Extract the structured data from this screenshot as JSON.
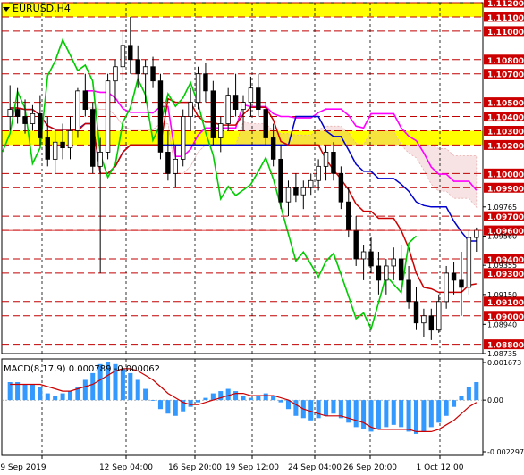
{
  "chart_title": "EURUSD,H4",
  "macd_label": "MACD(8,17,9) 0.000789 -0.000062",
  "colors": {
    "bull_candle": "#000000",
    "bear_candle": "#000000",
    "signal_red": "#cc0000",
    "kijun_blue": "#0000cc",
    "chikou_green": "#00cc00",
    "tenkan_magenta": "#ff00ff",
    "cloud_hatch": "#e8b0b0",
    "resistance_zone": "#ffff00",
    "level_lines": "#c00000",
    "price_label_bg": "#cc0000",
    "current_price_bg": "#cc0000",
    "macd_hist": "#3399ff",
    "macd_signal": "#cc0000"
  },
  "chart_data": {
    "type": "candlestick",
    "symbol": "EURUSD",
    "timeframe": "H4",
    "price_axis": {
      "min": 1.08735,
      "max": 1.112,
      "tick_labels": [
        "1.11200",
        "1.11100",
        "1.11000",
        "1.10800",
        "1.10700",
        "1.10500",
        "1.10400",
        "1.10300",
        "1.10200",
        "1.10000",
        "1.09900",
        "1.09765",
        "1.09700",
        "1.09600",
        "1.09560",
        "1.09400",
        "1.09355",
        "1.09300",
        "1.09150",
        "1.09100",
        "1.09000",
        "1.08940",
        "1.08800",
        "1.08735"
      ]
    },
    "time_axis_labels": [
      "9 Sep 2019",
      "12 Sep 04:00",
      "16 Sep 20:00",
      "19 Sep 12:00",
      "24 Sep 04:00",
      "26 Sep 20:00",
      "1 Oct 12:00"
    ],
    "horizontal_levels": [
      1.112,
      1.111,
      1.11,
      1.108,
      1.107,
      1.105,
      1.104,
      1.103,
      1.102,
      1.1,
      1.099,
      1.097,
      1.096,
      1.094,
      1.093,
      1.091,
      1.09,
      1.088
    ],
    "highlighted_levels": [
      {
        "price": 1.112,
        "text": "1.11200"
      },
      {
        "price": 1.111,
        "text": "1.11100"
      },
      {
        "price": 1.11,
        "text": "1.11000"
      },
      {
        "price": 1.108,
        "text": "1.10800"
      },
      {
        "price": 1.107,
        "text": "1.10700"
      },
      {
        "price": 1.105,
        "text": "1.10500"
      },
      {
        "price": 1.104,
        "text": "1.10400"
      },
      {
        "price": 1.103,
        "text": "1.10300"
      },
      {
        "price": 1.102,
        "text": "1.10200"
      },
      {
        "price": 1.1,
        "text": "1.10000"
      },
      {
        "price": 1.099,
        "text": "1.09900"
      },
      {
        "price": 1.097,
        "text": "1.09700"
      },
      {
        "price": 1.096,
        "text": "1.09600"
      },
      {
        "price": 1.094,
        "text": "1.09400"
      },
      {
        "price": 1.093,
        "text": "1.09300"
      },
      {
        "price": 1.091,
        "text": "1.09100"
      },
      {
        "price": 1.09,
        "text": "1.09000"
      },
      {
        "price": 1.088,
        "text": "1.08800"
      }
    ],
    "plain_levels": [
      {
        "price": 1.09765,
        "text": "1.09765"
      },
      {
        "price": 1.0956,
        "text": "1.09560"
      },
      {
        "price": 1.09355,
        "text": "1.09355"
      },
      {
        "price": 1.0915,
        "text": "1.09150"
      },
      {
        "price": 1.0894,
        "text": "1.08940"
      },
      {
        "price": 1.08735,
        "text": "1.08735"
      }
    ],
    "current_price": {
      "price": 1.096,
      "text": "1.09600"
    },
    "yellow_zones": [
      [
        1.111,
        1.112
      ],
      [
        1.102,
        1.103
      ]
    ],
    "candles": [
      [
        1.104,
        1.1062,
        1.103,
        1.1045
      ],
      [
        1.1045,
        1.106,
        1.1035,
        1.104
      ],
      [
        1.104,
        1.1052,
        1.1028,
        1.1035
      ],
      [
        1.1035,
        1.1048,
        1.103,
        1.1042
      ],
      [
        1.1042,
        1.1055,
        1.102,
        1.1025
      ],
      [
        1.1025,
        1.104,
        1.1005,
        1.101
      ],
      [
        1.101,
        1.103,
        1.1,
        1.1022
      ],
      [
        1.1022,
        1.1035,
        1.101,
        1.1018
      ],
      [
        1.1018,
        1.104,
        1.101,
        1.103
      ],
      [
        1.103,
        1.106,
        1.1025,
        1.1058
      ],
      [
        1.1058,
        1.107,
        1.104,
        1.1045
      ],
      [
        1.1045,
        1.105,
        1.1,
        1.1005
      ],
      [
        1.1005,
        1.1025,
        1.093,
        1.1015
      ],
      [
        1.1015,
        1.107,
        1.101,
        1.1065
      ],
      [
        1.1065,
        1.108,
        1.105,
        1.1075
      ],
      [
        1.1075,
        1.11,
        1.1065,
        1.109
      ],
      [
        1.109,
        1.111,
        1.107,
        1.108
      ],
      [
        1.108,
        1.109,
        1.106,
        1.107
      ],
      [
        1.107,
        1.108,
        1.105,
        1.1075
      ],
      [
        1.1075,
        1.1082,
        1.106,
        1.1065
      ],
      [
        1.1065,
        1.107,
        1.101,
        1.1015
      ],
      [
        1.1015,
        1.103,
        1.0995,
        1.1
      ],
      [
        1.1,
        1.102,
        1.099,
        1.101
      ],
      [
        1.101,
        1.1045,
        1.1005,
        1.104
      ],
      [
        1.104,
        1.106,
        1.103,
        1.105
      ],
      [
        1.105,
        1.1075,
        1.1045,
        1.107
      ],
      [
        1.107,
        1.1078,
        1.105,
        1.1058
      ],
      [
        1.1058,
        1.1065,
        1.102,
        1.1025
      ],
      [
        1.1025,
        1.104,
        1.1015,
        1.1035
      ],
      [
        1.1035,
        1.106,
        1.103,
        1.1055
      ],
      [
        1.1055,
        1.107,
        1.104,
        1.1045
      ],
      [
        1.1045,
        1.1055,
        1.103,
        1.105
      ],
      [
        1.105,
        1.1068,
        1.104,
        1.106
      ],
      [
        1.106,
        1.107,
        1.104,
        1.1045
      ],
      [
        1.1045,
        1.105,
        1.102,
        1.1025
      ],
      [
        1.1025,
        1.1035,
        1.1005,
        1.101
      ],
      [
        1.101,
        1.102,
        1.0975,
        1.098
      ],
      [
        1.098,
        1.0995,
        1.097,
        1.099
      ],
      [
        1.099,
        1.1,
        1.098,
        1.0985
      ],
      [
        1.0985,
        1.0995,
        1.0975,
        1.099
      ],
      [
        1.099,
        1.1,
        1.0985,
        1.0995
      ],
      [
        1.0995,
        1.101,
        1.0988,
        1.1005
      ],
      [
        1.1005,
        1.102,
        1.0995,
        1.1015
      ],
      [
        1.1015,
        1.1022,
        1.0995,
        1.1
      ],
      [
        1.1,
        1.1005,
        1.0975,
        1.098
      ],
      [
        1.098,
        1.099,
        1.0955,
        1.096
      ],
      [
        1.096,
        1.097,
        1.0935,
        1.094
      ],
      [
        1.094,
        1.095,
        1.0925,
        1.0945
      ],
      [
        1.0945,
        1.0955,
        1.093,
        1.0935
      ],
      [
        1.0935,
        1.0945,
        1.0915,
        1.0925
      ],
      [
        1.0925,
        1.094,
        1.0915,
        1.0935
      ],
      [
        1.0935,
        1.0948,
        1.0925,
        1.094
      ],
      [
        1.094,
        1.095,
        1.092,
        1.0925
      ],
      [
        1.0925,
        1.0935,
        1.0905,
        1.091
      ],
      [
        1.091,
        1.092,
        1.089,
        1.0895
      ],
      [
        1.0895,
        1.0905,
        1.0885,
        1.09
      ],
      [
        1.09,
        1.0905,
        1.0883,
        1.089
      ],
      [
        1.089,
        1.0915,
        1.0888,
        1.091
      ],
      [
        1.091,
        1.0935,
        1.0905,
        1.093
      ],
      [
        1.093,
        1.0938,
        1.0915,
        1.0925
      ],
      [
        1.0925,
        1.0945,
        1.09,
        1.092
      ],
      [
        1.092,
        1.096,
        1.0915,
        1.0955
      ],
      [
        1.0955,
        1.0962,
        1.0945,
        1.096
      ]
    ],
    "macd_axis": {
      "min": -0.002297,
      "max": 0.001673,
      "tick_labels": [
        "0.001673",
        "0.00",
        "-0.002297"
      ]
    },
    "macd_histogram": [
      0.0008,
      0.0008,
      0.0007,
      0.0007,
      0.0006,
      0.0003,
      0.0002,
      0.0003,
      0.0004,
      0.0006,
      0.0009,
      0.0012,
      0.0016,
      0.0017,
      0.0016,
      0.0014,
      0.0012,
      0.0009,
      0.0005,
      0.0,
      -0.0004,
      -0.0006,
      -0.0007,
      -0.0005,
      -0.0003,
      -0.0001,
      0.0001,
      0.0003,
      0.0004,
      0.0005,
      0.0004,
      0.0002,
      0.0001,
      0.0002,
      0.0003,
      0.0002,
      -0.0001,
      -0.0004,
      -0.0007,
      -0.0008,
      -0.0009,
      -0.0008,
      -0.0007,
      -0.0006,
      -0.0008,
      -0.001,
      -0.0012,
      -0.0013,
      -0.0014,
      -0.0013,
      -0.0012,
      -0.0011,
      -0.0012,
      -0.0014,
      -0.0015,
      -0.0014,
      -0.0012,
      -0.001,
      -0.0007,
      -0.0003,
      0.0002,
      0.0006,
      0.0008
    ],
    "macd_signal": [
      0.0007,
      0.0007,
      0.0007,
      0.0007,
      0.0007,
      0.0006,
      0.0005,
      0.0004,
      0.0004,
      0.0005,
      0.0006,
      0.0007,
      0.0009,
      0.0011,
      0.0013,
      0.0014,
      0.0014,
      0.0013,
      0.0011,
      0.0009,
      0.0006,
      0.0003,
      0.0001,
      -0.0001,
      -0.0002,
      -0.0002,
      -0.0001,
      0.0,
      0.0001,
      0.0002,
      0.0003,
      0.0003,
      0.0002,
      0.0002,
      0.0002,
      0.0002,
      0.0001,
      0.0,
      -0.0002,
      -0.0004,
      -0.0005,
      -0.0006,
      -0.0007,
      -0.0007,
      -0.0007,
      -0.0008,
      -0.0009,
      -0.001,
      -0.0012,
      -0.0013,
      -0.0013,
      -0.0013,
      -0.0013,
      -0.0013,
      -0.0014,
      -0.0014,
      -0.0014,
      -0.0013,
      -0.0011,
      -0.0009,
      -0.0006,
      -0.0003,
      -0.0001
    ]
  }
}
